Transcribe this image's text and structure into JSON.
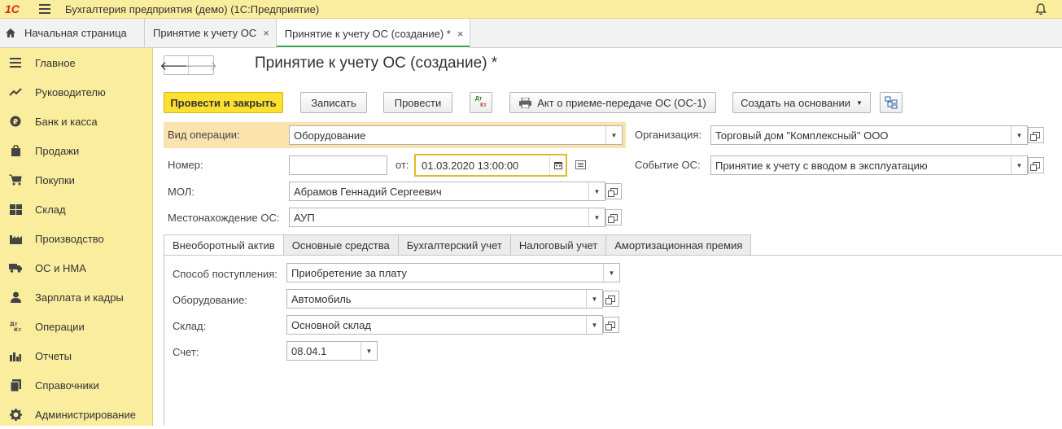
{
  "app": {
    "logo": "1С",
    "title": "Бухгалтерия предприятия (демо)  (1С:Предприятие)"
  },
  "tabs": {
    "home": "Начальная страница",
    "items": [
      {
        "label": "Принятие к учету ОС",
        "close": "×"
      },
      {
        "label": "Принятие к учету ОС (создание) *",
        "close": "×"
      }
    ]
  },
  "sidebar": {
    "items": [
      {
        "label": "Главное",
        "icon": "menu-icon"
      },
      {
        "label": "Руководителю",
        "icon": "trend-icon"
      },
      {
        "label": "Банк и касса",
        "icon": "ruble-icon"
      },
      {
        "label": "Продажи",
        "icon": "bag-icon"
      },
      {
        "label": "Покупки",
        "icon": "cart-icon"
      },
      {
        "label": "Склад",
        "icon": "warehouse-icon"
      },
      {
        "label": "Производство",
        "icon": "factory-icon"
      },
      {
        "label": "ОС и НМА",
        "icon": "truck-icon"
      },
      {
        "label": "Зарплата и кадры",
        "icon": "person-icon"
      },
      {
        "label": "Операции",
        "icon": "dt-kt-icon"
      },
      {
        "label": "Отчеты",
        "icon": "bar-chart-icon"
      },
      {
        "label": "Справочники",
        "icon": "books-icon"
      },
      {
        "label": "Администрирование",
        "icon": "gear-icon"
      }
    ]
  },
  "form": {
    "title": "Принятие к учету ОС (создание) *",
    "toolbar": {
      "post_close": "Провести и закрыть",
      "save": "Записать",
      "post": "Провести",
      "dtkt_top": "Дт",
      "dtkt_bottom": "Кт",
      "print_act": "Акт о приеме-передаче ОС (ОС-1)",
      "create_based": "Создать на основании"
    },
    "fields": {
      "operation_label": "Вид операции:",
      "operation_value": "Оборудование",
      "org_label": "Организация:",
      "org_value": "Торговый дом \"Комплексный\" ООО",
      "number_label": "Номер:",
      "number_value": "",
      "from_label": "от:",
      "date_value": "01.03.2020 13:00:00",
      "event_label": "Событие ОС:",
      "event_value": "Принятие к учету с вводом в эксплуатацию",
      "mol_label": "МОЛ:",
      "mol_value": "Абрамов Геннадий Сергеевич",
      "location_label": "Местонахождение ОС:",
      "location_value": "АУП"
    },
    "inner_tabs": [
      "Внеоборотный актив",
      "Основные средства",
      "Бухгалтерский учет",
      "Налоговый учет",
      "Амортизационная премия"
    ],
    "asset": {
      "receipt_label": "Способ поступления:",
      "receipt_value": "Приобретение за плату",
      "equipment_label": "Оборудование:",
      "equipment_value": "Автомобиль",
      "warehouse_label": "Склад:",
      "warehouse_value": "Основной склад",
      "account_label": "Счет:",
      "account_value": "08.04.1"
    }
  },
  "colors": {
    "accent_yellow": "#fbed9e",
    "primary_button": "#fbe02f",
    "active_tab_underline": "#3e9c4c",
    "logo_red": "#d7261e"
  }
}
